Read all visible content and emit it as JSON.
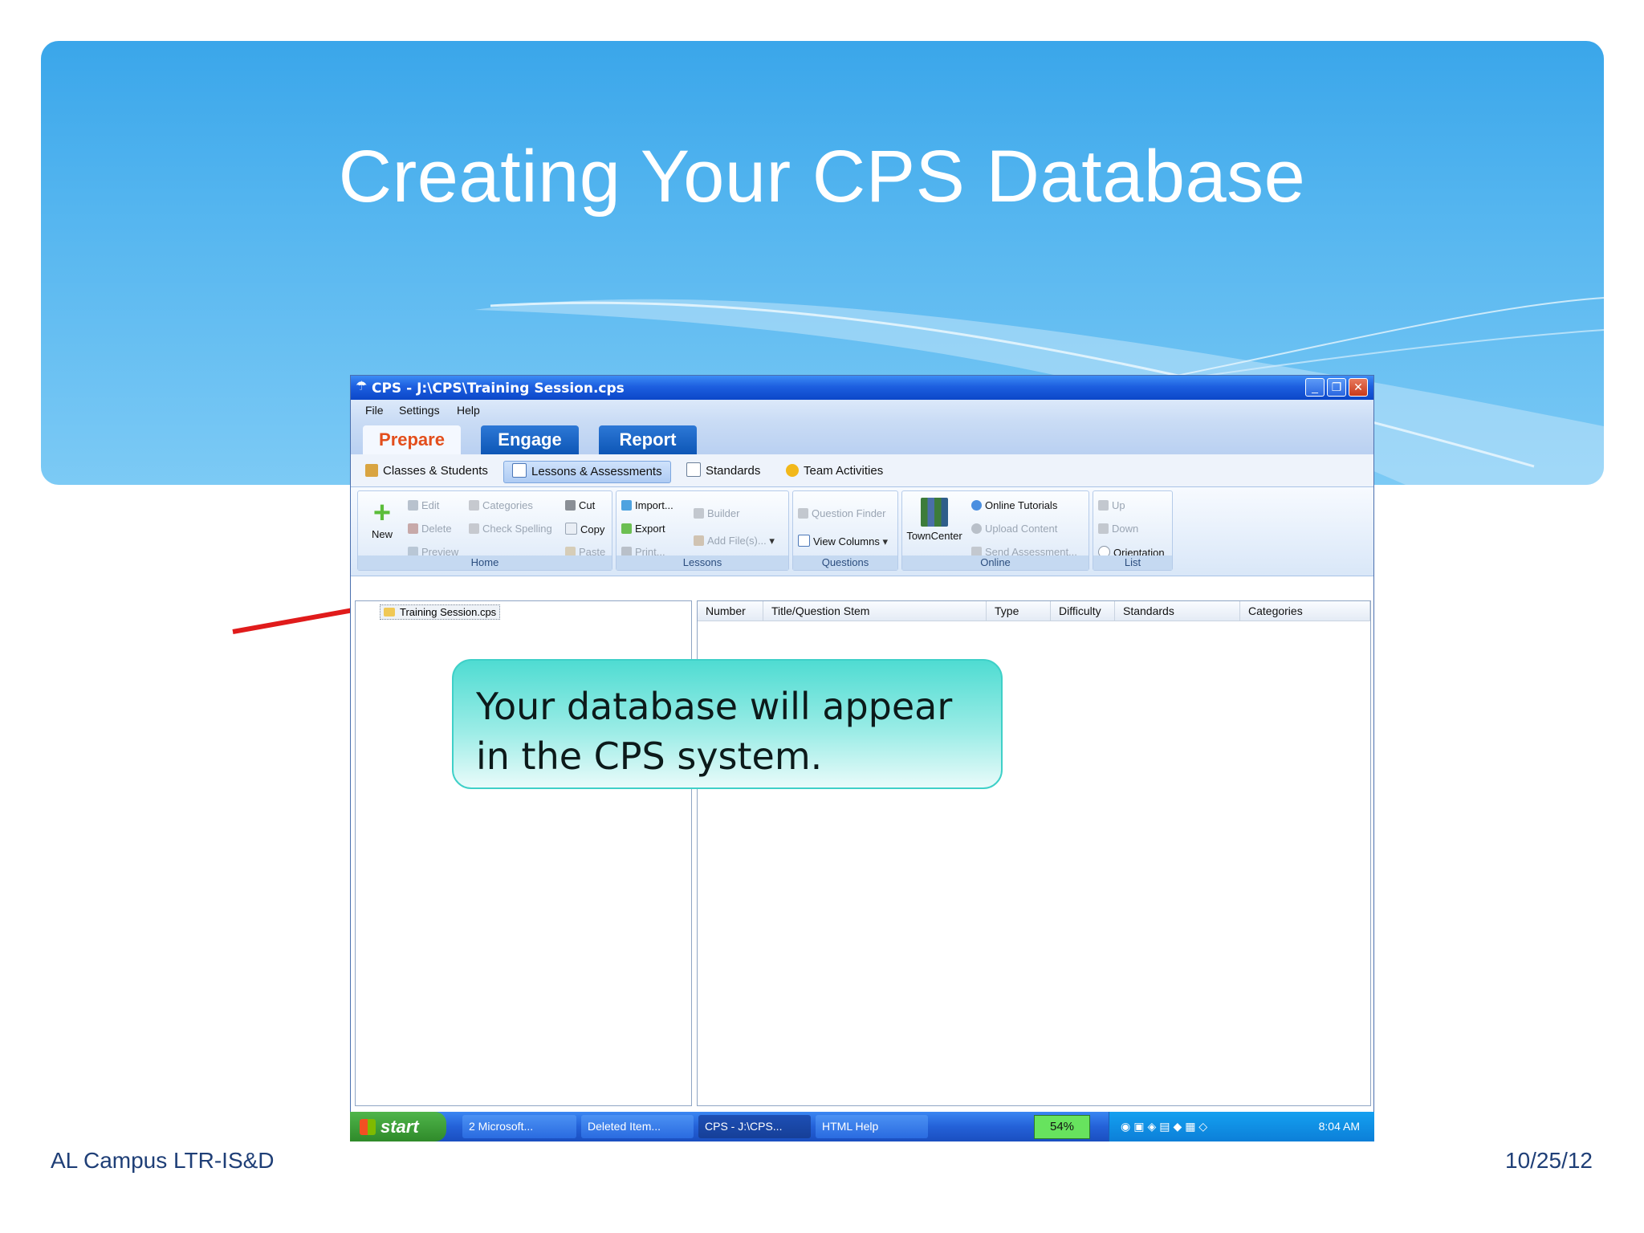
{
  "slide": {
    "title": "Creating Your CPS Database",
    "footer_left": "AL Campus LTR-IS&D",
    "footer_right": "10/25/12",
    "callout": "Your database will appear in the CPS system."
  },
  "window": {
    "title": "CPS - J:\\CPS\\Training Session.cps",
    "menu": [
      "File",
      "Settings",
      "Help"
    ],
    "main_tabs": [
      {
        "label": "Prepare",
        "active": true
      },
      {
        "label": "Engage",
        "active": false
      },
      {
        "label": "Report",
        "active": false
      }
    ],
    "sub_tabs": [
      {
        "label": "Classes & Students"
      },
      {
        "label": "Lessons & Assessments",
        "active": true
      },
      {
        "label": "Standards"
      },
      {
        "label": "Team Activities"
      }
    ],
    "ribbon": {
      "home": {
        "label": "Home",
        "new": "New",
        "edit": "Edit",
        "delete": "Delete",
        "preview": "Preview",
        "categories": "Categories",
        "check_spelling": "Check Spelling",
        "cut": "Cut",
        "copy": "Copy",
        "paste": "Paste"
      },
      "lessons": {
        "label": "Lessons",
        "import": "Import...",
        "export": "Export",
        "print": "Print...",
        "builder": "Builder",
        "add_files": "Add File(s)..."
      },
      "questions": {
        "label": "Questions",
        "question_finder": "Question Finder",
        "view_columns": "View Columns"
      },
      "online": {
        "label": "Online",
        "towncenter": "TownCenter",
        "online_tutorials": "Online Tutorials",
        "upload_content": "Upload Content",
        "send_assessment": "Send Assessment..."
      },
      "list": {
        "label": "List",
        "up": "Up",
        "down": "Down",
        "orientation": "Orientation"
      }
    },
    "tree_item": "Training Session.cps",
    "columns": [
      "Number",
      "Title/Question Stem",
      "Type",
      "Difficulty",
      "Standards",
      "Categories"
    ]
  },
  "taskbar": {
    "start": "start",
    "items": [
      "2 Microsoft...",
      "Deleted Item...",
      "CPS - J:\\CPS...",
      "HTML Help"
    ],
    "battery": "54%",
    "clock": "8:04 AM"
  },
  "colors": {
    "banner_blue": "#3aa6ea",
    "title_bar_blue": "#1d5fe0",
    "prepare_orange": "#e34e1c",
    "callout_teal": "#4fdcd2",
    "arrow_red": "#e01b1b",
    "start_green": "#3a9a35"
  }
}
